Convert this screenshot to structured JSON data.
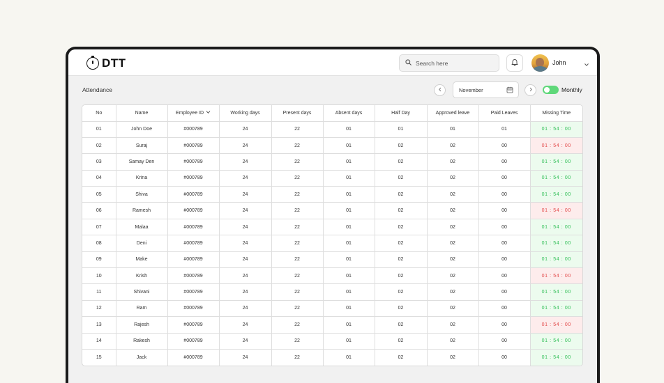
{
  "brand": {
    "logo_text": "DTT",
    "logo_icon": "stopwatch-icon"
  },
  "search": {
    "placeholder": "Search here",
    "icon": "search-icon"
  },
  "notifications": {
    "icon": "bell-icon"
  },
  "user": {
    "name": "John",
    "menu_icon": "chevron-down-icon"
  },
  "page": {
    "title": "Attendance"
  },
  "period": {
    "month": "November",
    "prev_icon": "chevron-left-icon",
    "next_icon": "chevron-right-icon",
    "calendar_icon": "calendar-icon",
    "view_toggle_label": "Monthly",
    "view_toggle_on": true
  },
  "colors": {
    "accent_green": "#5fd87a",
    "ok_bg": "#ecfbee",
    "ok_text": "#2fbe55",
    "bad_bg": "#fdecec",
    "bad_text": "#e24848"
  },
  "table": {
    "columns": [
      "No",
      "Name",
      "Employee ID",
      "Working days",
      "Present days",
      "Absent days",
      "Half Day",
      "Approved leave",
      "Paid Leaves",
      "Missing Time"
    ],
    "sort_column": "Employee ID",
    "rows": [
      {
        "no": "01",
        "name": "John Doe",
        "emp_id": "#000789",
        "working": "24",
        "present": "22",
        "absent": "01",
        "half": "01",
        "approved": "01",
        "paid": "01",
        "missing": "01 : 54 : 00",
        "status": "ok"
      },
      {
        "no": "02",
        "name": "Suraj",
        "emp_id": "#000789",
        "working": "24",
        "present": "22",
        "absent": "01",
        "half": "02",
        "approved": "02",
        "paid": "00",
        "missing": "01 : 54 : 00",
        "status": "bad"
      },
      {
        "no": "03",
        "name": "Samay Den",
        "emp_id": "#000789",
        "working": "24",
        "present": "22",
        "absent": "01",
        "half": "02",
        "approved": "02",
        "paid": "00",
        "missing": "01 : 54 : 00",
        "status": "ok"
      },
      {
        "no": "04",
        "name": "Krina",
        "emp_id": "#000789",
        "working": "24",
        "present": "22",
        "absent": "01",
        "half": "02",
        "approved": "02",
        "paid": "00",
        "missing": "01 : 54 : 00",
        "status": "ok"
      },
      {
        "no": "05",
        "name": "Shiva",
        "emp_id": "#000789",
        "working": "24",
        "present": "22",
        "absent": "01",
        "half": "02",
        "approved": "02",
        "paid": "00",
        "missing": "01 : 54 : 00",
        "status": "ok"
      },
      {
        "no": "06",
        "name": "Ramesh",
        "emp_id": "#000789",
        "working": "24",
        "present": "22",
        "absent": "01",
        "half": "02",
        "approved": "02",
        "paid": "00",
        "missing": "01 : 54 : 00",
        "status": "bad"
      },
      {
        "no": "07",
        "name": "Malaa",
        "emp_id": "#000789",
        "working": "24",
        "present": "22",
        "absent": "01",
        "half": "02",
        "approved": "02",
        "paid": "00",
        "missing": "01 : 54 : 00",
        "status": "ok"
      },
      {
        "no": "08",
        "name": "Deni",
        "emp_id": "#000789",
        "working": "24",
        "present": "22",
        "absent": "01",
        "half": "02",
        "approved": "02",
        "paid": "00",
        "missing": "01 : 54 : 00",
        "status": "ok"
      },
      {
        "no": "09",
        "name": "Make",
        "emp_id": "#000789",
        "working": "24",
        "present": "22",
        "absent": "01",
        "half": "02",
        "approved": "02",
        "paid": "00",
        "missing": "01 : 54 : 00",
        "status": "ok"
      },
      {
        "no": "10",
        "name": "Krish",
        "emp_id": "#000789",
        "working": "24",
        "present": "22",
        "absent": "01",
        "half": "02",
        "approved": "02",
        "paid": "00",
        "missing": "01 : 54 : 00",
        "status": "bad"
      },
      {
        "no": "11",
        "name": "Shivani",
        "emp_id": "#000789",
        "working": "24",
        "present": "22",
        "absent": "01",
        "half": "02",
        "approved": "02",
        "paid": "00",
        "missing": "01 : 54 : 00",
        "status": "ok"
      },
      {
        "no": "12",
        "name": "Ram",
        "emp_id": "#000789",
        "working": "24",
        "present": "22",
        "absent": "01",
        "half": "02",
        "approved": "02",
        "paid": "00",
        "missing": "01 : 54 : 00",
        "status": "ok"
      },
      {
        "no": "13",
        "name": "Rajesh",
        "emp_id": "#000789",
        "working": "24",
        "present": "22",
        "absent": "01",
        "half": "02",
        "approved": "02",
        "paid": "00",
        "missing": "01 : 54 : 00",
        "status": "bad"
      },
      {
        "no": "14",
        "name": "Rakesh",
        "emp_id": "#000789",
        "working": "24",
        "present": "22",
        "absent": "01",
        "half": "02",
        "approved": "02",
        "paid": "00",
        "missing": "01 : 54 : 00",
        "status": "ok"
      },
      {
        "no": "15",
        "name": "Jack",
        "emp_id": "#000789",
        "working": "24",
        "present": "22",
        "absent": "01",
        "half": "02",
        "approved": "02",
        "paid": "00",
        "missing": "01 : 54 : 00",
        "status": "ok"
      }
    ]
  }
}
